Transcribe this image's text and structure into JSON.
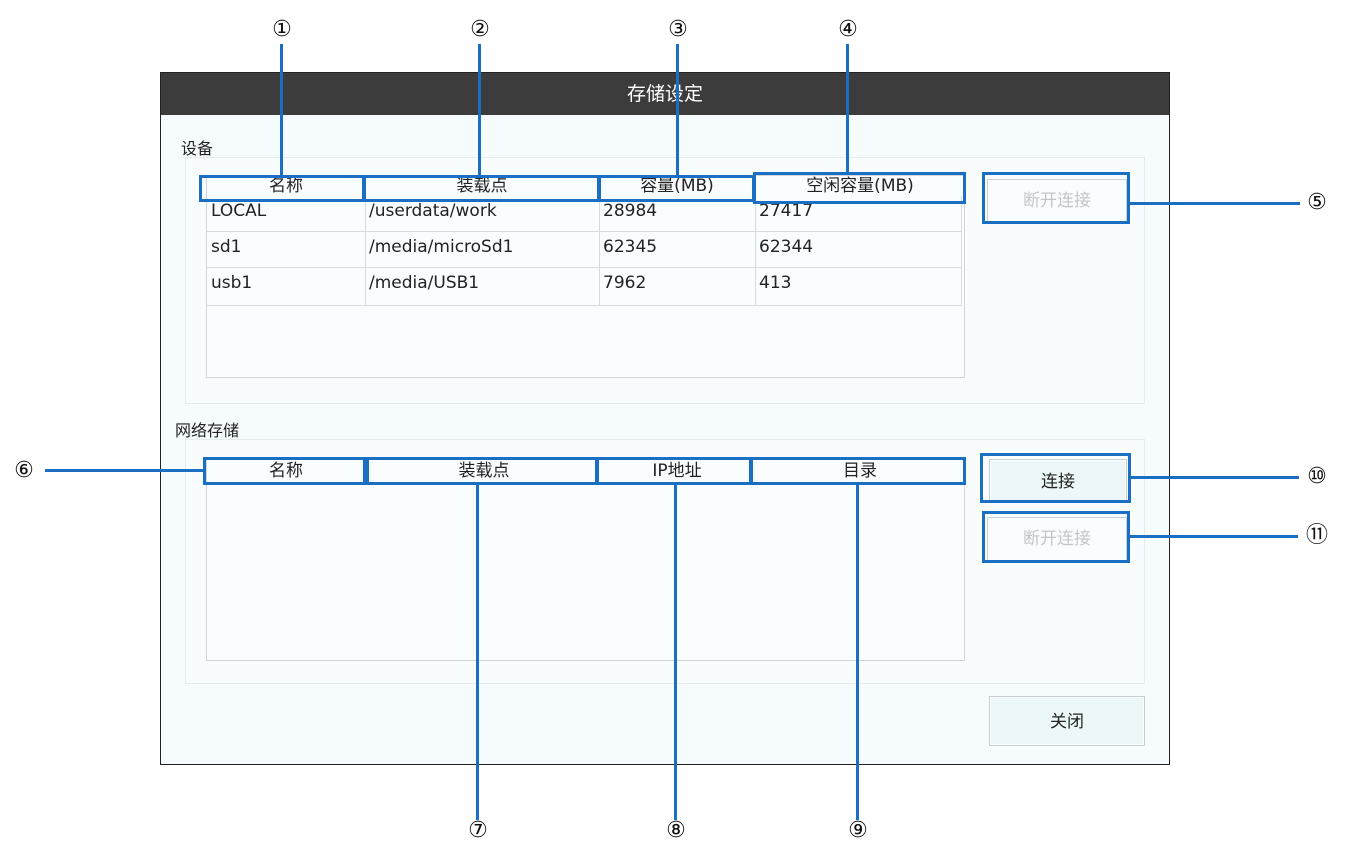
{
  "dialog": {
    "title": "存储设定",
    "devices_label": "设备",
    "network_label": "网络存储",
    "close_label": "关闭"
  },
  "devices": {
    "headers": [
      "名称",
      "装载点",
      "容量(MB)",
      "空闲容量(MB)"
    ],
    "rows": [
      [
        "LOCAL",
        "/userdata/work",
        "28984",
        "27417"
      ],
      [
        "sd1",
        "/media/microSd1",
        "62345",
        "62344"
      ],
      [
        "usb1",
        "/media/USB1",
        "7962",
        "413"
      ]
    ],
    "disconnect_label": "断开连接",
    "disconnect_enabled": false
  },
  "network": {
    "headers": [
      "名称",
      "装载点",
      "IP地址",
      "目录"
    ],
    "rows": [],
    "connect_label": "连接",
    "disconnect_label": "断开连接",
    "disconnect_enabled": false
  },
  "callouts": [
    "①",
    "②",
    "③",
    "④",
    "⑤",
    "⑥",
    "⑦",
    "⑧",
    "⑨",
    "⑩",
    "⑪"
  ],
  "colors": {
    "title_bar": "#3c3c3c",
    "dialog_bg": "#f6fcfd",
    "callout_blue": "#1a6fc2",
    "disabled_text": "#c5c5c5"
  }
}
